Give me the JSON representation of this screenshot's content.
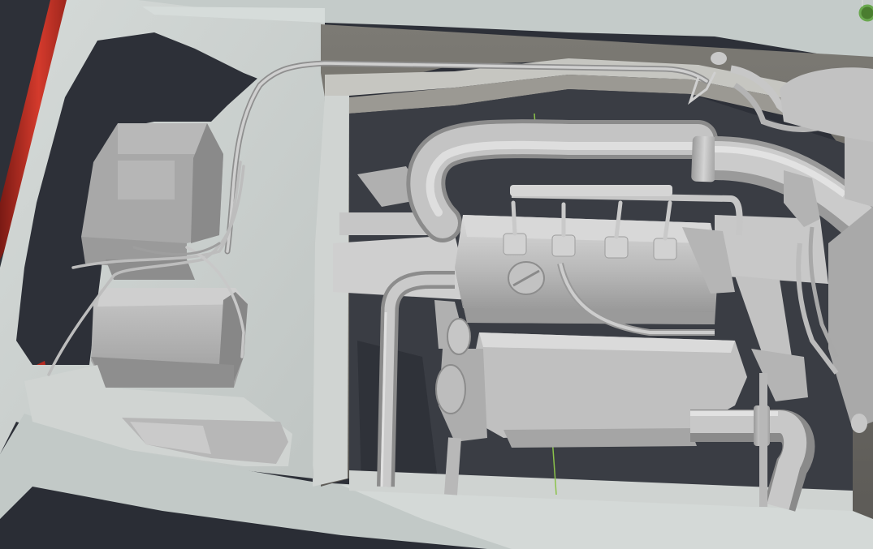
{
  "viewport": {
    "view": "3d-viewport",
    "background_color": "#2d3038",
    "car_body_color": "#c9cfcd",
    "model_color": "#b8b8b8",
    "body_paint_color": "#b52a20",
    "axis_line_color": "#8bc34a",
    "gizmo_color": "#6aa84f"
  },
  "scene": {
    "objects": [
      "engine-block-mesh",
      "intake-pipe-mesh",
      "exhaust-pipe-mesh",
      "battery-box-mesh",
      "air-filter-box-mesh",
      "wiring-harness-mesh",
      "engine-bay-frame-mesh",
      "car-body-mesh"
    ]
  }
}
